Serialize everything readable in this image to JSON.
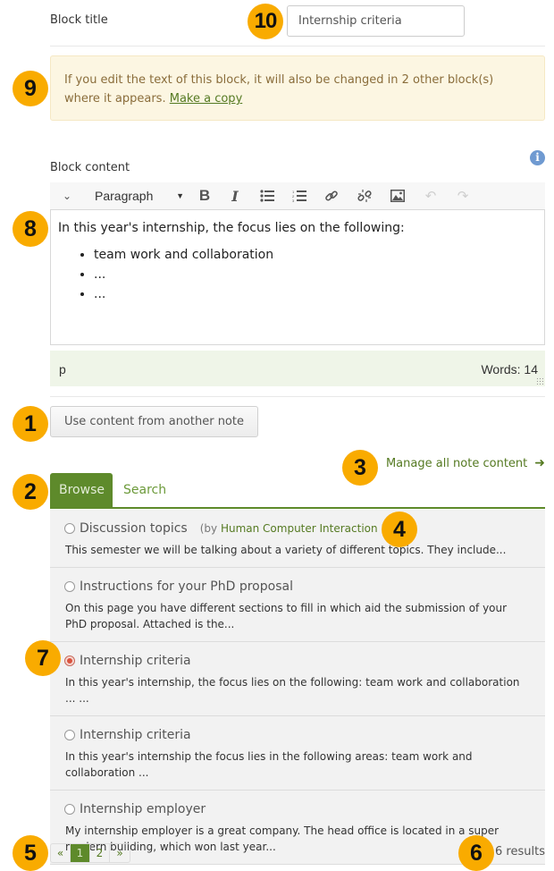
{
  "block_title": {
    "label": "Block title",
    "value": "Internship criteria"
  },
  "alert": {
    "text": "If you edit the text of this block, it will also be changed in 2 other block(s) where it appears.",
    "link": "Make a copy"
  },
  "block_content": {
    "label": "Block content",
    "info_icon": "info-icon",
    "toolbar": {
      "toggle_icon": "chevron-down-icon",
      "format_select": "Paragraph",
      "buttons": [
        "bold",
        "italic",
        "bulleted-list",
        "numbered-list",
        "link",
        "unlink",
        "image",
        "undo",
        "redo"
      ]
    },
    "editor": {
      "paragraph": "In this year's internship, the focus lies on the following:",
      "bullets": [
        "team work and collaboration",
        "...",
        "..."
      ]
    },
    "statusbar": {
      "path": "p",
      "word_count": "Words: 14"
    }
  },
  "use_content_button": "Use content from another note",
  "manage_link": "Manage all note content",
  "tabs": [
    {
      "label": "Browse",
      "active": true
    },
    {
      "label": "Search",
      "active": false
    }
  ],
  "notes": [
    {
      "title": "Discussion topics",
      "owner_prefix": "(by ",
      "owner": "Human Computer Interaction 101",
      "owner_suffix": ")",
      "desc": "This semester we will be talking about a variety of different topics. They include...",
      "checked": false
    },
    {
      "title": "Instructions for your PhD proposal",
      "desc": "On this page you have different sections to fill in which aid the submission of your PhD proposal. Attached is the...",
      "checked": false
    },
    {
      "title": "Internship criteria",
      "desc": "In this year's internship, the focus lies on the following: team work and collaboration ... ...",
      "checked": true
    },
    {
      "title": "Internship criteria",
      "desc": "In this year's internship the focus lies in the following areas: team work and collaboration ...",
      "checked": false
    },
    {
      "title": "Internship employer",
      "desc": "My internship employer is a great company. The head office is located in a super modern building, which won last year...",
      "checked": false
    }
  ],
  "pagination": {
    "prev": "«",
    "pages": [
      "1",
      "2"
    ],
    "current": "1",
    "next": "»"
  },
  "results": "6 results",
  "callouts": [
    "1",
    "2",
    "3",
    "4",
    "5",
    "6",
    "7",
    "8",
    "9",
    "10"
  ],
  "colors": {
    "accent": "#5e8a2b",
    "link": "#557a22",
    "callout": "#f9ab00",
    "alert_bg": "#fcf6e2"
  }
}
